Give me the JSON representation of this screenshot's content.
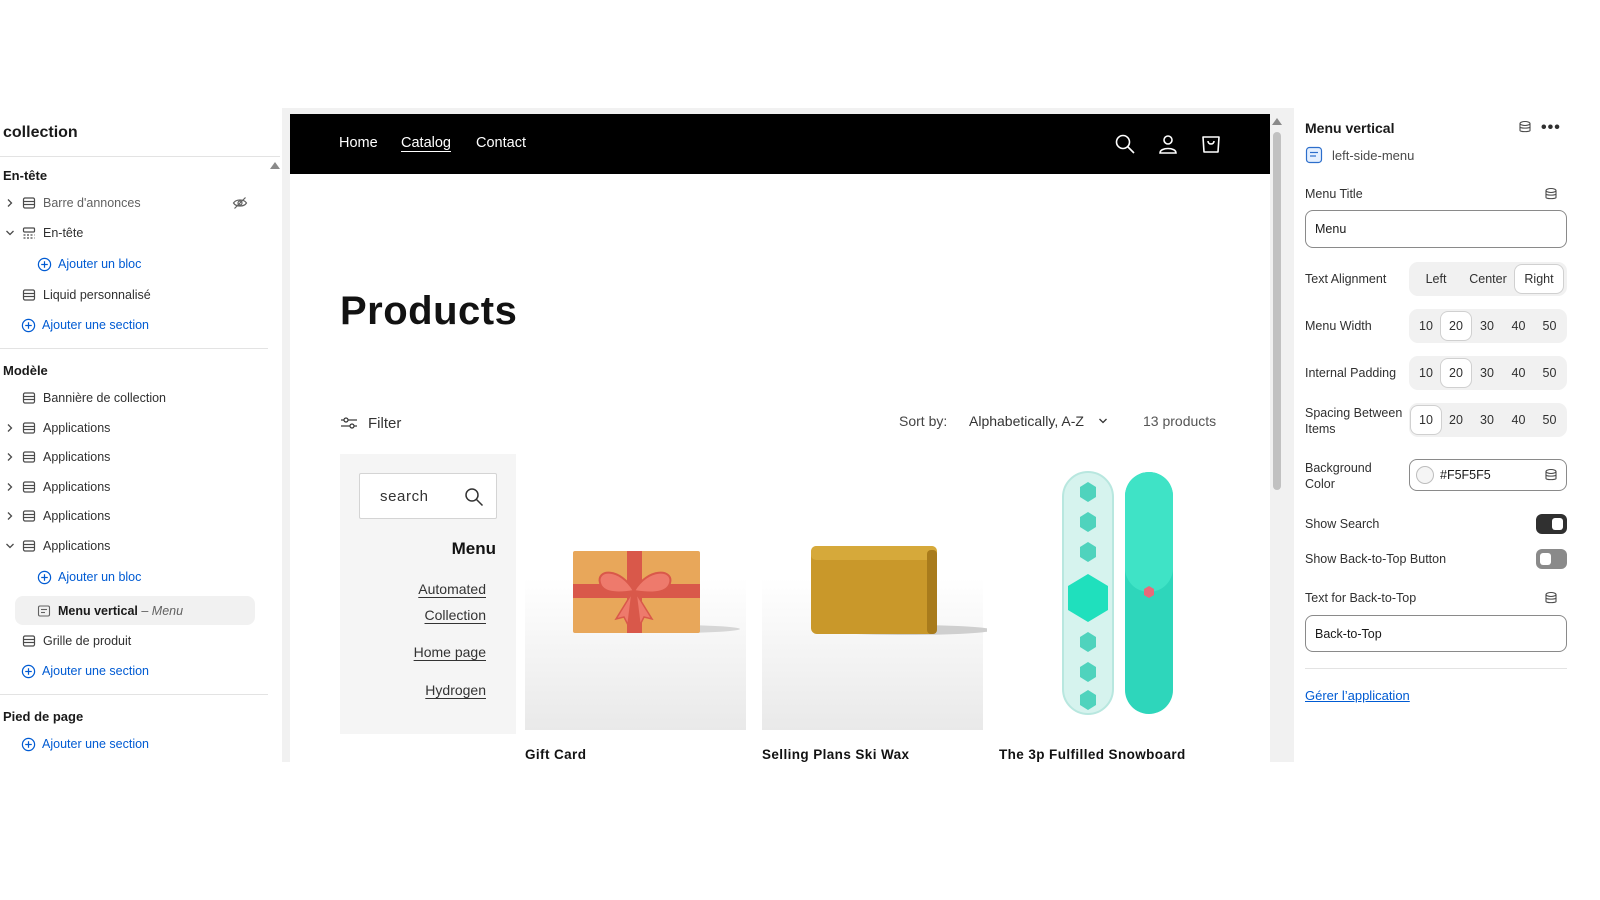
{
  "sidebar": {
    "title": "collection",
    "groups": {
      "header": "En-tête",
      "template": "Modèle",
      "footer": "Pied de page"
    },
    "items": [
      {
        "label": "Barre d'annonces"
      },
      {
        "label": "En-tête"
      },
      {
        "label": "Ajouter un bloc"
      },
      {
        "label": "Liquid personnalisé"
      },
      {
        "label": "Ajouter une section"
      },
      {
        "label": "Bannière de collection"
      },
      {
        "label": "Applications"
      },
      {
        "label": "Applications"
      },
      {
        "label": "Applications"
      },
      {
        "label": "Applications"
      },
      {
        "label": "Applications"
      },
      {
        "label": "Ajouter un bloc"
      },
      {
        "label": "Menu vertical",
        "sub": "– Menu"
      },
      {
        "label": "Grille de produit"
      },
      {
        "label": "Ajouter une section"
      },
      {
        "label": "Ajouter une section"
      }
    ]
  },
  "store": {
    "nav": [
      "Home",
      "Catalog",
      "Contact"
    ],
    "active_nav": "Catalog",
    "icons": [
      "search-icon",
      "account-icon",
      "cart-icon"
    ],
    "heading": "Products",
    "filter_label": "Filter",
    "sort_label": "Sort by:",
    "sort_value": "Alphabetically, A-Z",
    "product_count": "13 products",
    "vertical_menu": {
      "search_placeholder": "search",
      "title": "Menu",
      "links": [
        "Automated Collection",
        "Home page",
        "Hydrogen"
      ]
    },
    "products": [
      {
        "title": "Gift Card"
      },
      {
        "title": "Selling Plans Ski Wax"
      },
      {
        "title": "The 3p Fulfilled Snowboard"
      }
    ]
  },
  "settings": {
    "title": "Menu vertical",
    "app_name": "left-side-menu",
    "menu_title_label": "Menu Title",
    "menu_title_value": "Menu",
    "text_alignment_label": "Text Alignment",
    "text_alignment_options": [
      "Left",
      "Center",
      "Right"
    ],
    "text_alignment_selected": "Right",
    "menu_width_label": "Menu Width",
    "internal_padding_label": "Internal Padding",
    "spacing_label": "Spacing Between Items",
    "number_options": [
      "10",
      "20",
      "30",
      "40",
      "50"
    ],
    "menu_width_selected": "20",
    "internal_padding_selected": "20",
    "spacing_selected": "10",
    "bg_color_label": "Background Color",
    "bg_color_value": "#F5F5F5",
    "show_search_label": "Show Search",
    "show_search_on": true,
    "show_back_to_top_label": "Show Back-to-Top Button",
    "show_back_to_top_on": false,
    "back_to_top_text_label": "Text for Back-to-Top",
    "back_to_top_text_value": "Back-to-Top",
    "manage_app_link": "Gérer l’application"
  },
  "colors": {
    "accent_link": "#005bd3",
    "nav_bg": "#000000",
    "toggle_on": "#303030",
    "toggle_off": "#8a8a8a"
  }
}
